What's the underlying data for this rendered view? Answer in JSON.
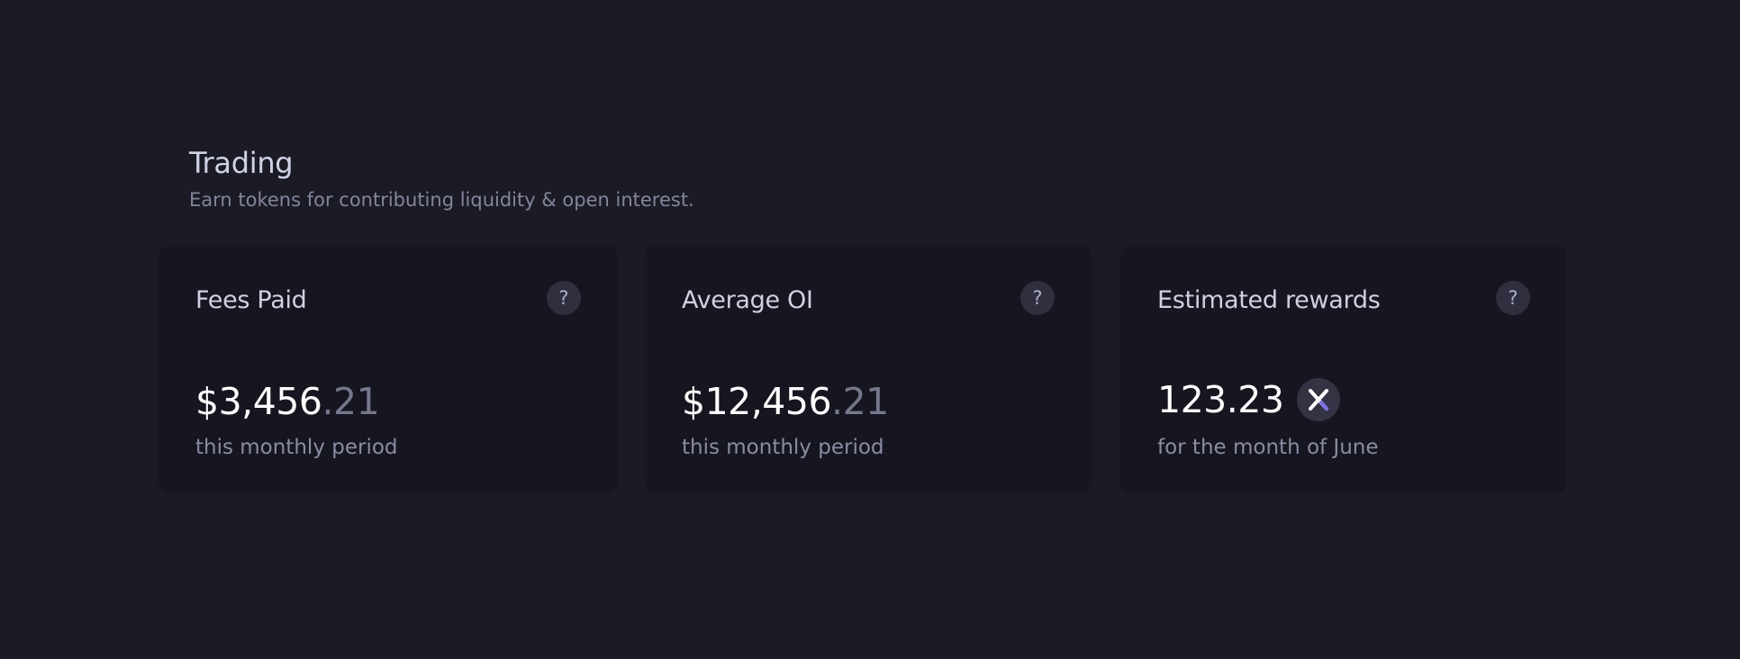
{
  "section": {
    "title": "Trading",
    "subtitle": "Earn tokens for contributing liquidity & open interest."
  },
  "cards": [
    {
      "title": "Fees Paid",
      "help": "?",
      "value_main": "$3,456",
      "value_decimal": ".21",
      "caption": "this monthly period"
    },
    {
      "title": "Average OI",
      "help": "?",
      "value_main": "$12,456",
      "value_decimal": ".21",
      "caption": "this monthly period"
    },
    {
      "title": "Estimated rewards",
      "help": "?",
      "value_main": "123.23",
      "token_icon": "x-token-icon",
      "caption": "for the month of June"
    }
  ],
  "colors": {
    "background": "#1b1b26",
    "card": "#161621",
    "accent": "#7b6cf6"
  }
}
